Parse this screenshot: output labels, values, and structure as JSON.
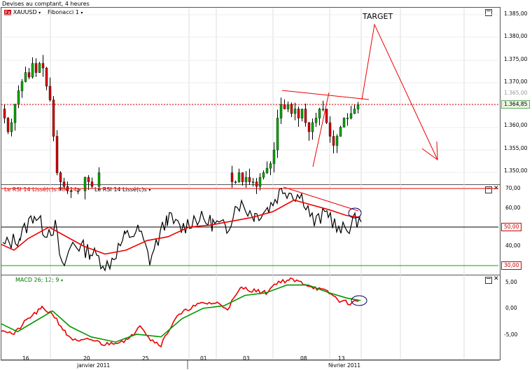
{
  "window": {
    "title": "Devises au comptant, 4 heures"
  },
  "toolbar": {
    "symbol": "XAUUSD",
    "symbol_caret": "▾",
    "study": "Fibonacci 1",
    "study_caret": "▾",
    "fx_icon_text": "Fx"
  },
  "price_panel": {
    "annotation": "TARGET",
    "current_price": "1.364,85",
    "y_ticks": [
      "1.385,00",
      "1.380,00",
      "1.375,00",
      "1.370,00",
      "1.365,00",
      "1.360,00",
      "1.355,00",
      "1.350,00"
    ],
    "colors": {
      "up": "#00aa00",
      "down": "#dd0000",
      "level_line": "#dd0000",
      "trendline": "#ee0000",
      "price_tag_bg": "#e8f5e0"
    }
  },
  "rsi_panel": {
    "title_left": "Le RSI 14 Lissé(c)s MM 14",
    "title_right": "Le RSI 14 Lissé(c)s",
    "y_ticks": [
      "70,00",
      "60,00",
      "50,00",
      "40,00",
      "30,00"
    ],
    "level_50_tag": "50,00",
    "level_30_tag": "30,00",
    "colors": {
      "rsi": "#000000",
      "ma": "#ee0000",
      "level70": "#ee0000",
      "level50": "#000000",
      "level30": "#00aa00"
    }
  },
  "macd_panel": {
    "title": "MACD 26; 12; 9",
    "y_ticks": [
      "5,00",
      "0,00",
      "-5,00"
    ],
    "colors": {
      "macd": "#ee0000",
      "signal": "#009900"
    }
  },
  "x_axis": {
    "day_ticks": [
      "16",
      "20",
      "25",
      "01",
      "03",
      "08",
      "13"
    ],
    "months": [
      "janvier 2011",
      "février 2011"
    ]
  },
  "chart_data": [
    {
      "type": "candlestick",
      "title": "XAUUSD",
      "ylim": [
        1346,
        1387
      ],
      "annotations": [
        "TARGET"
      ]
    },
    {
      "type": "line",
      "title": "Le RSI 14 Lissé(c)s",
      "ylim": [
        24,
        72
      ],
      "reference_lines": [
        70,
        50,
        30
      ]
    },
    {
      "type": "line",
      "title": "MACD 26; 12; 9",
      "ylim": [
        -8,
        6
      ]
    }
  ]
}
